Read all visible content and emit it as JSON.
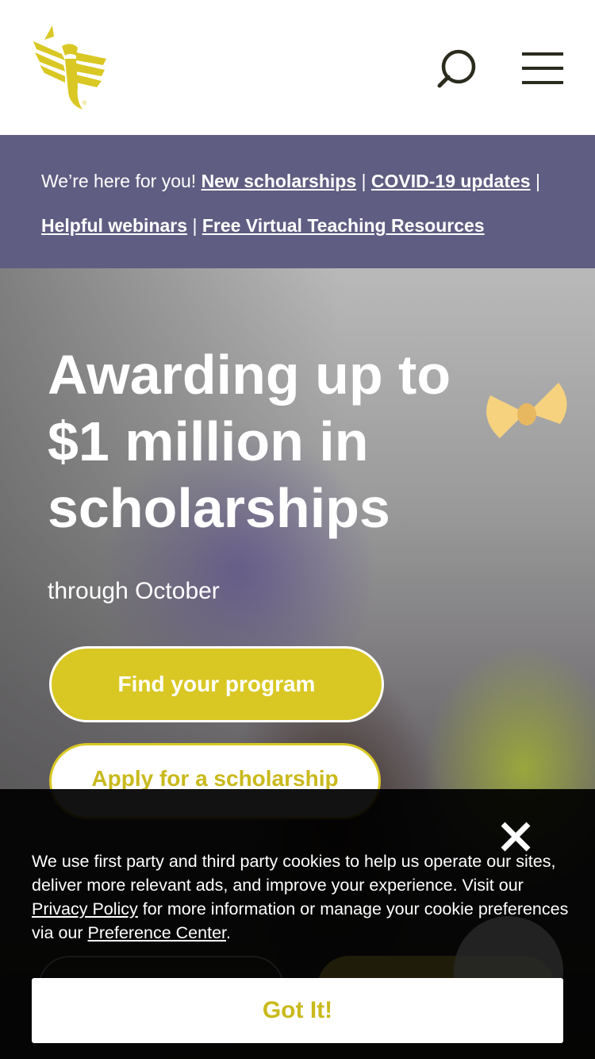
{
  "header": {
    "logo_alt": "Phoenix logo",
    "logo_color": "#d9c823",
    "search_icon": "search-icon",
    "menu_icon": "hamburger-menu-icon"
  },
  "alert": {
    "intro": "We’re here for you!",
    "sep": "|",
    "links": [
      "New scholarships",
      "COVID-19 updates",
      "Helpful webinars",
      "Free Virtual Teaching Resources"
    ],
    "background": "#605d82"
  },
  "hero": {
    "title": "Awarding up to $1 million in scholarships",
    "subtitle": "through October",
    "primary_cta": "Find your program",
    "secondary_cta": "Apply for a scholarship",
    "accent": "#d9c823"
  },
  "cookie": {
    "text_1": "We use first party and third party cookies to help us operate our sites, deliver more relevant ads, and improve your experience. Visit our ",
    "privacy_link": "Privacy Policy",
    "text_2": " for more information or manage your cookie preferences via our ",
    "preference_link": "Preference Center",
    "text_3": ".",
    "accept": "Got It!",
    "close_icon": "close-icon"
  }
}
